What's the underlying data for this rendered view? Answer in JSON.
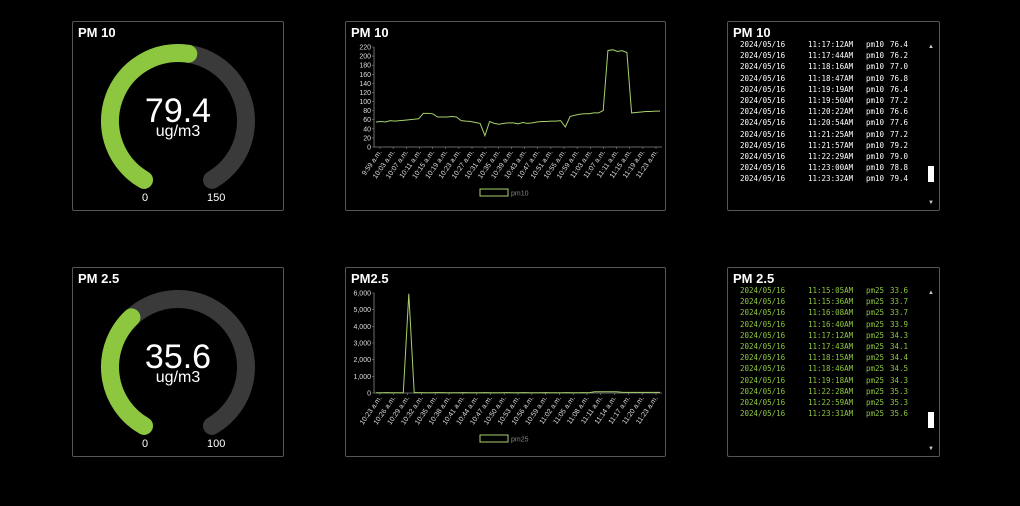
{
  "pm10_gauge": {
    "title": "PM 10",
    "value": "79.4",
    "unit": "ug/m3",
    "min": "0",
    "max": "150",
    "fraction": 0.529,
    "color": "#8dc63f"
  },
  "pm25_gauge": {
    "title": "PM 2.5",
    "value": "35.6",
    "unit": "ug/m3",
    "min": "0",
    "max": "100",
    "fraction": 0.356,
    "color": "#8dc63f"
  },
  "pm10_chart": {
    "title": "PM 10",
    "legend": "pm10",
    "chart_data": {
      "type": "line",
      "yticks": [
        0,
        20,
        40,
        60,
        80,
        100,
        120,
        140,
        160,
        180,
        200,
        220
      ],
      "ylim": [
        0,
        220
      ],
      "xticks": [
        "9:59 a.m.",
        "10:03 a.m.",
        "10:07 a.m.",
        "10:11 a.m.",
        "10:15 a.m.",
        "10:19 a.m.",
        "10:23 a.m.",
        "10:27 a.m.",
        "10:31 a.m.",
        "10:35 a.m.",
        "10:39 a.m.",
        "10:43 a.m.",
        "10:47 a.m.",
        "10:51 a.m.",
        "10:55 a.m.",
        "10:59 a.m.",
        "11:03 a.m.",
        "11:07 a.m.",
        "11:11 a.m.",
        "11:15 a.m.",
        "11:19 a.m.",
        "11:23 a.m."
      ],
      "series": [
        {
          "name": "pm10",
          "values": [
            55,
            56,
            55,
            58,
            57,
            58,
            59,
            60,
            61,
            62,
            74,
            74,
            73,
            66,
            66,
            66,
            67,
            66,
            58,
            57,
            56,
            54,
            52,
            25,
            56,
            52,
            50,
            52,
            53,
            53,
            51,
            54,
            52,
            53,
            55,
            56,
            56,
            57,
            57,
            58,
            44,
            67,
            70,
            72,
            73,
            73,
            75,
            75,
            80,
            212,
            214,
            210,
            212,
            208,
            75,
            76,
            77,
            78,
            78,
            79,
            79
          ]
        }
      ]
    }
  },
  "pm25_chart": {
    "title": "PM2.5",
    "legend": "pm25",
    "chart_data": {
      "type": "line",
      "yticks": [
        "0",
        "1,000",
        "2,000",
        "3,000",
        "4,000",
        "5,000",
        "6,000"
      ],
      "ylim": [
        0,
        6000
      ],
      "xticks": [
        "10:23 a.m.",
        "10:26 a.m.",
        "10:29 a.m.",
        "10:32 a.m.",
        "10:35 a.m.",
        "10:38 a.m.",
        "10:41 a.m.",
        "10:44 a.m.",
        "10:47 a.m.",
        "10:50 a.m.",
        "10:53 a.m.",
        "10:56 a.m.",
        "10:59 a.m.",
        "11:02 a.m.",
        "11:05 a.m.",
        "11:08 a.m.",
        "11:11 a.m.",
        "11:14 a.m.",
        "11:17 a.m.",
        "11:20 a.m.",
        "11:23 a.m."
      ],
      "series": [
        {
          "name": "pm25",
          "values": [
            20,
            20,
            22,
            21,
            20,
            20,
            5950,
            25,
            22,
            21,
            20,
            22,
            22,
            21,
            20,
            21,
            22,
            21,
            20,
            21,
            22,
            21,
            20,
            21,
            22,
            21,
            20,
            22,
            21,
            20,
            21,
            22,
            21,
            20,
            21,
            22,
            21,
            20,
            22,
            21,
            70,
            75,
            72,
            70,
            71,
            40,
            36,
            35,
            34,
            34,
            35,
            36,
            35
          ]
        }
      ]
    }
  },
  "pm10_log": {
    "title": "PM 10",
    "color": "#ffffff",
    "rows": [
      {
        "date": "2024/05/16",
        "time": "11:17:12AM",
        "name": "pm10",
        "value": "76.4"
      },
      {
        "date": "2024/05/16",
        "time": "11:17:44AM",
        "name": "pm10",
        "value": "76.2"
      },
      {
        "date": "2024/05/16",
        "time": "11:18:16AM",
        "name": "pm10",
        "value": "77.0"
      },
      {
        "date": "2024/05/16",
        "time": "11:18:47AM",
        "name": "pm10",
        "value": "76.8"
      },
      {
        "date": "2024/05/16",
        "time": "11:19:19AM",
        "name": "pm10",
        "value": "76.4"
      },
      {
        "date": "2024/05/16",
        "time": "11:19:50AM",
        "name": "pm10",
        "value": "77.2"
      },
      {
        "date": "2024/05/16",
        "time": "11:20:22AM",
        "name": "pm10",
        "value": "76.6"
      },
      {
        "date": "2024/05/16",
        "time": "11:20:54AM",
        "name": "pm10",
        "value": "77.6"
      },
      {
        "date": "2024/05/16",
        "time": "11:21:25AM",
        "name": "pm10",
        "value": "77.2"
      },
      {
        "date": "2024/05/16",
        "time": "11:21:57AM",
        "name": "pm10",
        "value": "79.2"
      },
      {
        "date": "2024/05/16",
        "time": "11:22:29AM",
        "name": "pm10",
        "value": "79.0"
      },
      {
        "date": "2024/05/16",
        "time": "11:23:00AM",
        "name": "pm10",
        "value": "78.8"
      },
      {
        "date": "2024/05/16",
        "time": "11:23:32AM",
        "name": "pm10",
        "value": "79.4"
      }
    ]
  },
  "pm25_log": {
    "title": "PM 2.5",
    "color": "#8dc63f",
    "rows": [
      {
        "date": "2024/05/16",
        "time": "11:15:05AM",
        "name": "pm25",
        "value": "33.6"
      },
      {
        "date": "2024/05/16",
        "time": "11:15:36AM",
        "name": "pm25",
        "value": "33.7"
      },
      {
        "date": "2024/05/16",
        "time": "11:16:08AM",
        "name": "pm25",
        "value": "33.7"
      },
      {
        "date": "2024/05/16",
        "time": "11:16:40AM",
        "name": "pm25",
        "value": "33.9"
      },
      {
        "date": "2024/05/16",
        "time": "11:17:12AM",
        "name": "pm25",
        "value": "34.3"
      },
      {
        "date": "2024/05/16",
        "time": "11:17:43AM",
        "name": "pm25",
        "value": "34.1"
      },
      {
        "date": "2024/05/16",
        "time": "11:18:15AM",
        "name": "pm25",
        "value": "34.4"
      },
      {
        "date": "2024/05/16",
        "time": "11:18:46AM",
        "name": "pm25",
        "value": "34.5"
      },
      {
        "date": "2024/05/16",
        "time": "11:19:18AM",
        "name": "pm25",
        "value": "34.3"
      },
      {
        "date": "2024/05/16",
        "time": "11:22:28AM",
        "name": "pm25",
        "value": "35.3"
      },
      {
        "date": "2024/05/16",
        "time": "11:22:59AM",
        "name": "pm25",
        "value": "35.3"
      },
      {
        "date": "2024/05/16",
        "time": "11:23:31AM",
        "name": "pm25",
        "value": "35.6"
      }
    ]
  },
  "colors": {
    "accent": "#8dc63f",
    "track": "#3a3a3a",
    "border": "#555555"
  }
}
